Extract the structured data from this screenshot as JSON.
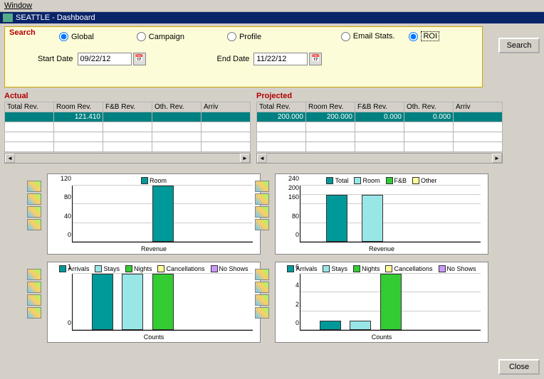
{
  "menu": {
    "window": "Window"
  },
  "title": "SEATTLE - Dashboard",
  "search": {
    "title": "Search",
    "radios": {
      "global": "Global",
      "campaign": "Campaign",
      "profile": "Profile",
      "email_stats": "Email Stats.",
      "roi": "ROI"
    },
    "start_label": "Start Date",
    "start_value": "09/22/12",
    "end_label": "End Date",
    "end_value": "11/22/12",
    "search_btn": "Search"
  },
  "actual": {
    "title": "Actual",
    "cols": [
      "Total Rev.",
      "Room Rev.",
      "F&B Rev.",
      "Oth. Rev.",
      "Arriv"
    ],
    "row": [
      "",
      "121.410",
      "",
      "",
      ""
    ]
  },
  "projected": {
    "title": "Projected",
    "cols": [
      "Total Rev.",
      "Room Rev.",
      "F&B Rev.",
      "Oth. Rev.",
      "Arriv"
    ],
    "row": [
      "200.000",
      "200.000",
      "0.000",
      "0.000",
      ""
    ]
  },
  "close_btn": "Close",
  "chart_data": [
    {
      "type": "bar",
      "title": "Revenue",
      "legend": [
        {
          "name": "Room",
          "color": "#009999"
        }
      ],
      "ylim": [
        0,
        120
      ],
      "yticks": [
        0,
        40,
        80,
        120
      ],
      "bars": [
        {
          "x": 0,
          "value": 120,
          "color": "#009999"
        }
      ]
    },
    {
      "type": "bar",
      "title": "Revenue",
      "legend": [
        {
          "name": "Total",
          "color": "#009999"
        },
        {
          "name": "Room",
          "color": "#99e6e6"
        },
        {
          "name": "F&B",
          "color": "#33cc33"
        },
        {
          "name": "Other",
          "color": "#ffff99"
        }
      ],
      "ylim": [
        0,
        240
      ],
      "yticks": [
        0,
        80,
        160,
        200,
        240
      ],
      "bars": [
        {
          "x": 0,
          "value": 200,
          "color": "#009999"
        },
        {
          "x": 1,
          "value": 200,
          "color": "#99e6e6"
        },
        {
          "x": 2,
          "value": 0,
          "color": "#33cc33"
        },
        {
          "x": 3,
          "value": 0,
          "color": "#ffff99"
        }
      ]
    },
    {
      "type": "bar",
      "title": "Counts",
      "legend": [
        {
          "name": "Arrivals",
          "color": "#009999"
        },
        {
          "name": "Stays",
          "color": "#99e6e6"
        },
        {
          "name": "Nights",
          "color": "#33cc33"
        },
        {
          "name": "Cancellations",
          "color": "#ffff99"
        },
        {
          "name": "No Shows",
          "color": "#cc99ff"
        }
      ],
      "ylim": [
        0,
        1
      ],
      "yticks": [
        0,
        1
      ],
      "bars": [
        {
          "x": 0,
          "value": 1,
          "color": "#009999"
        },
        {
          "x": 1,
          "value": 1,
          "color": "#99e6e6"
        },
        {
          "x": 2,
          "value": 1,
          "color": "#33cc33"
        },
        {
          "x": 3,
          "value": 0,
          "color": "#ffff99"
        },
        {
          "x": 4,
          "value": 0,
          "color": "#cc99ff"
        }
      ]
    },
    {
      "type": "bar",
      "title": "Counts",
      "legend": [
        {
          "name": "Arrivals",
          "color": "#009999"
        },
        {
          "name": "Stays",
          "color": "#99e6e6"
        },
        {
          "name": "Nights",
          "color": "#33cc33"
        },
        {
          "name": "Cancellations",
          "color": "#ffff99"
        },
        {
          "name": "No Shows",
          "color": "#cc99ff"
        }
      ],
      "ylim": [
        0,
        6
      ],
      "yticks": [
        0,
        2,
        4,
        6
      ],
      "bars": [
        {
          "x": 0,
          "value": 1,
          "color": "#009999"
        },
        {
          "x": 1,
          "value": 1,
          "color": "#99e6e6"
        },
        {
          "x": 2,
          "value": 6,
          "color": "#33cc33"
        },
        {
          "x": 3,
          "value": 0,
          "color": "#ffff99"
        },
        {
          "x": 4,
          "value": 0,
          "color": "#cc99ff"
        }
      ]
    }
  ]
}
